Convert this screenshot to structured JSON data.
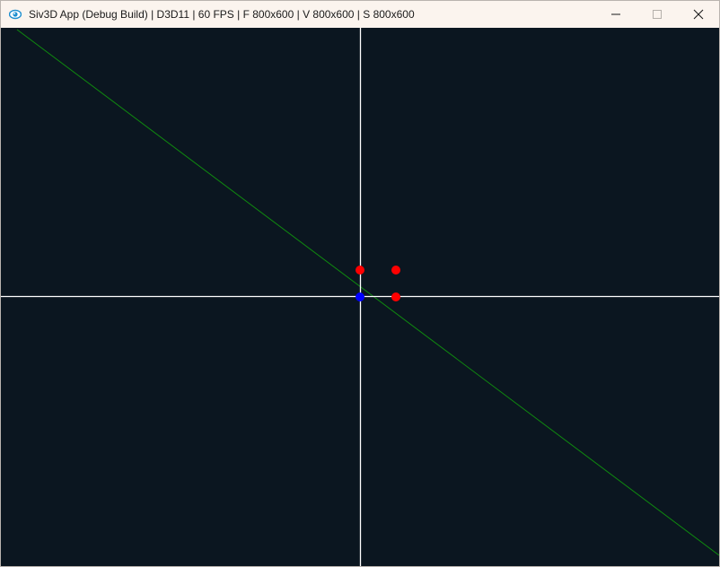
{
  "window": {
    "title": "Siv3D App (Debug Build) | D3D11 | 60 FPS | F 800x600 | V 800x600 | S 800x600",
    "icon": "siv3d-eye-icon",
    "controls": {
      "minimize_icon": "minimize-icon",
      "maximize_icon": "maximize-icon",
      "close_icon": "close-icon"
    }
  },
  "scene": {
    "background_color": "#0b1620",
    "axis_color": "#ffffff",
    "line_color": "#0f8a0f",
    "point_color_red": "#ff0000",
    "point_color_blue": "#0000ff"
  }
}
